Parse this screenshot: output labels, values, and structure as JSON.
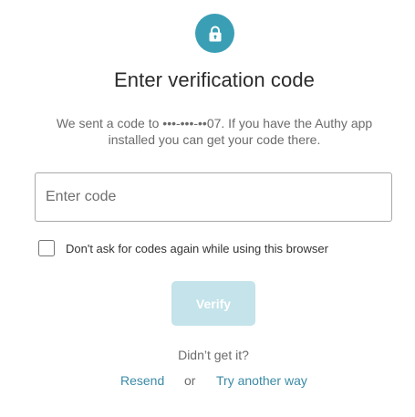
{
  "header": {
    "icon": "lock-icon",
    "accent_color": "#3a9fb5",
    "title": "Enter verification code",
    "subtitle": "We sent a code to •••-•••-••07. If you have the Authy app installed you can get your code there."
  },
  "form": {
    "code_input": {
      "value": "",
      "placeholder": "Enter code"
    },
    "remember_checkbox": {
      "checked": false,
      "label": "Don't ask for codes again while using this browser"
    },
    "verify_label": "Verify"
  },
  "footer": {
    "didnt_get": "Didn’t get it?",
    "resend_label": "Resend",
    "or_label": "or",
    "try_another_label": "Try another way",
    "link_color": "#3a8aa6"
  }
}
